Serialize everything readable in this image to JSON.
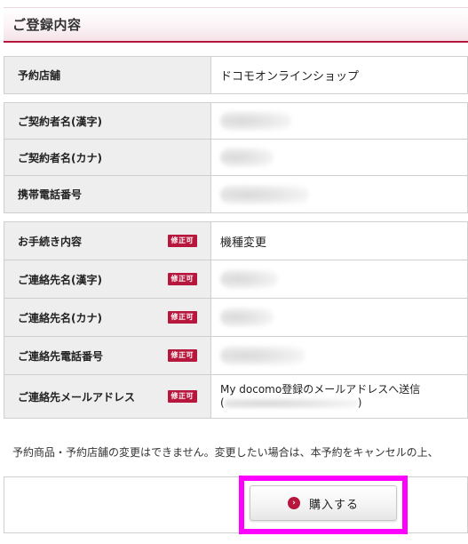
{
  "section": {
    "title": "ご登録内容"
  },
  "shop_table": {
    "rows": [
      {
        "label": "予約店舗",
        "value": "ドコモオンラインショップ"
      }
    ]
  },
  "contract_table": {
    "rows": [
      {
        "label": "ご契約者名(漢字)",
        "value": ""
      },
      {
        "label": "ご契約者名(カナ)",
        "value": ""
      },
      {
        "label": "携帯電話番号",
        "value": ""
      }
    ]
  },
  "procedure_table": {
    "badge": "修正可",
    "rows": [
      {
        "label": "お手続き内容",
        "value": "機種変更"
      },
      {
        "label": "ご連絡先名(漢字)",
        "value": ""
      },
      {
        "label": "ご連絡先名(カナ)",
        "value": ""
      },
      {
        "label": "ご連絡先電話番号",
        "value": ""
      },
      {
        "label": "ご連絡先メールアドレス",
        "value": "My docomo登録のメールアドレスへ送信",
        "value_line2_open": "(",
        "value_line2_close": ")"
      }
    ]
  },
  "notice": "予約商品・予約店舗の変更はできません。変更したい場合は、本予約をキャンセルの上、",
  "purchase_button": {
    "label": "購入する",
    "icon": "chevron-right-circle-icon"
  },
  "colors": {
    "accent": "#b8173d",
    "highlight": "#ff00ff",
    "label_bg": "#eeeeee",
    "border": "#cfcfcf"
  }
}
